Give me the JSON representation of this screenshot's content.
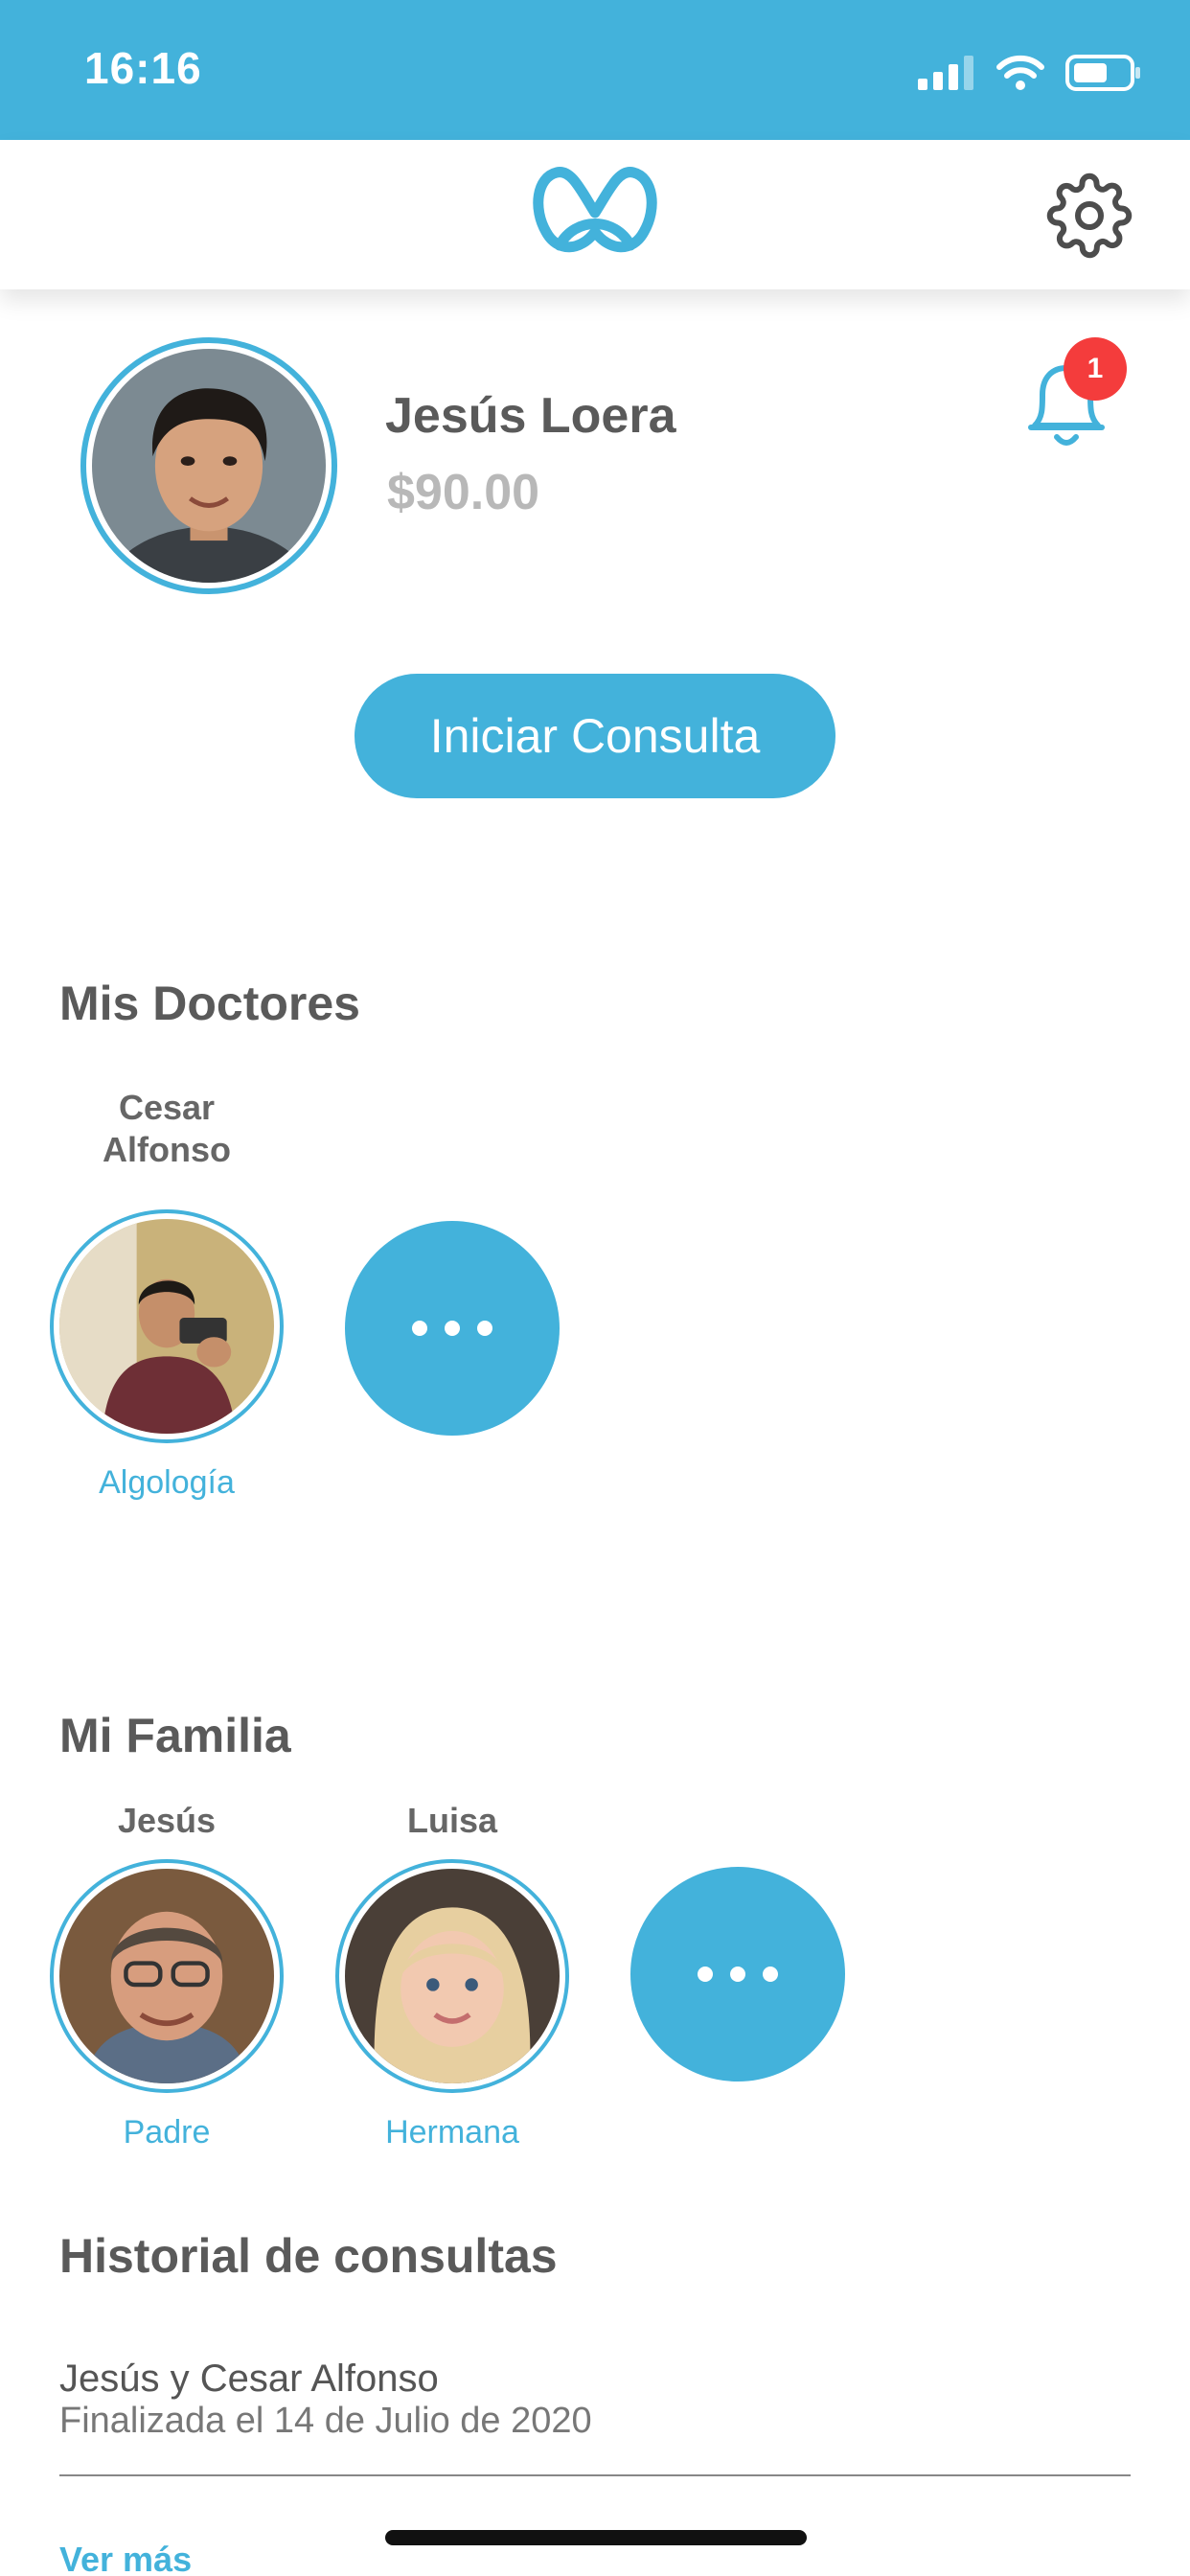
{
  "status_bar": {
    "time": "16:16"
  },
  "profile": {
    "name": "Jesús Loera",
    "balance": "$90.00",
    "notifications": "1"
  },
  "actions": {
    "start_consult": "Iniciar Consulta"
  },
  "doctors": {
    "title": "Mis Doctores",
    "items": [
      {
        "name": "Cesar\nAlfonso",
        "specialty": "Algología"
      }
    ]
  },
  "family": {
    "title": "Mi Familia",
    "items": [
      {
        "name": "Jesús",
        "relation": "Padre"
      },
      {
        "name": "Luisa",
        "relation": "Hermana"
      }
    ]
  },
  "history": {
    "title": "Historial de consultas",
    "items": [
      {
        "title": "Jesús y Cesar Alfonso",
        "subtitle": "Finalizada el 14 de Julio de 2020"
      }
    ],
    "see_more": "Ver más"
  },
  "colors": {
    "accent": "#43b2db",
    "badge": "#f43c3c",
    "text": "#5a5a5a"
  },
  "icons": [
    "signal-icon",
    "wifi-icon",
    "battery-icon",
    "app-logo-icon",
    "gear-icon",
    "bell-icon",
    "more-dots-icon"
  ]
}
